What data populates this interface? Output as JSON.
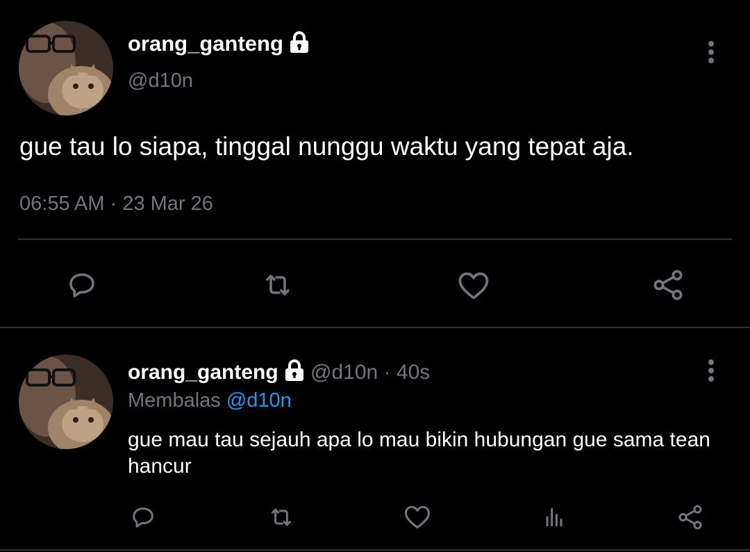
{
  "main_tweet": {
    "display_name": "orang_ganteng",
    "handle": "@d10n",
    "text": "gue tau lo siapa, tinggal nunggu waktu yang tepat aja.",
    "time": "06:55 AM",
    "separator": "·",
    "date": "23 Mar 26",
    "icons": {
      "lock": "lock-icon",
      "more": "more-vertical-icon",
      "reply": "reply-icon",
      "retweet": "retweet-icon",
      "like": "heart-icon",
      "share": "share-icon"
    }
  },
  "reply_tweet": {
    "display_name": "orang_ganteng",
    "handle": "@d10n",
    "separator": "·",
    "time_ago": "40s",
    "replying_prefix": "Membalas",
    "replying_to": "@d10n",
    "text": "gue mau tau sejauh apa lo mau bikin hubungan gue sama tean hancur",
    "icons": {
      "reply": "reply-icon",
      "retweet": "retweet-icon",
      "like": "heart-icon",
      "analytics": "analytics-icon",
      "share": "share-icon"
    }
  },
  "colors": {
    "background": "#000000",
    "primary_text": "#ffffff",
    "secondary_text": "#71767b",
    "link": "#1d9bf0",
    "divider": "#2f3336"
  }
}
